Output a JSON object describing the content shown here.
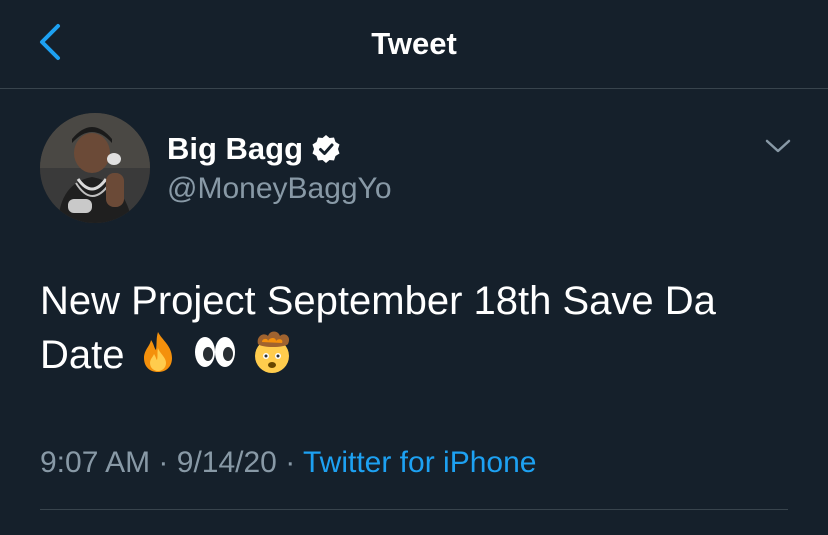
{
  "header": {
    "title": "Tweet",
    "back_icon": "chevron-left-icon"
  },
  "tweet": {
    "author": {
      "display_name": "Big Bagg",
      "handle": "@MoneyBaggYo",
      "verified": true
    },
    "text": "New Project September 18th Save Da Date",
    "emojis": [
      "fire-emoji",
      "eyes-emoji",
      "exploding-head-emoji"
    ],
    "time": "9:07 AM",
    "date": "9/14/20",
    "separator": "·",
    "source": "Twitter for iPhone"
  },
  "colors": {
    "background": "#15202b",
    "accent": "#1da1f2",
    "secondary_text": "#8899a6",
    "divider": "#38444d"
  }
}
